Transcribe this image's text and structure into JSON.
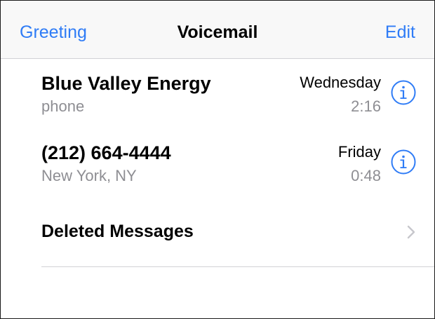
{
  "navbar": {
    "left_label": "Greeting",
    "title": "Voicemail",
    "right_label": "Edit"
  },
  "voicemails": [
    {
      "name": "Blue Valley Energy",
      "subtitle": "phone",
      "date": "Wednesday",
      "duration": "2:16",
      "icon": "info-icon"
    },
    {
      "name": "(212) 664-4444",
      "subtitle": "New York, NY",
      "date": "Friday",
      "duration": "0:48",
      "icon": "info-icon"
    }
  ],
  "deleted": {
    "label": "Deleted Messages",
    "icon": "chevron-right-icon"
  },
  "colors": {
    "accent": "#2f7cf6",
    "secondary_text": "#8e8e93",
    "navbar_bg": "#f8f8f8",
    "separator": "#d2d2d6",
    "chevron": "#c7c7cc"
  }
}
